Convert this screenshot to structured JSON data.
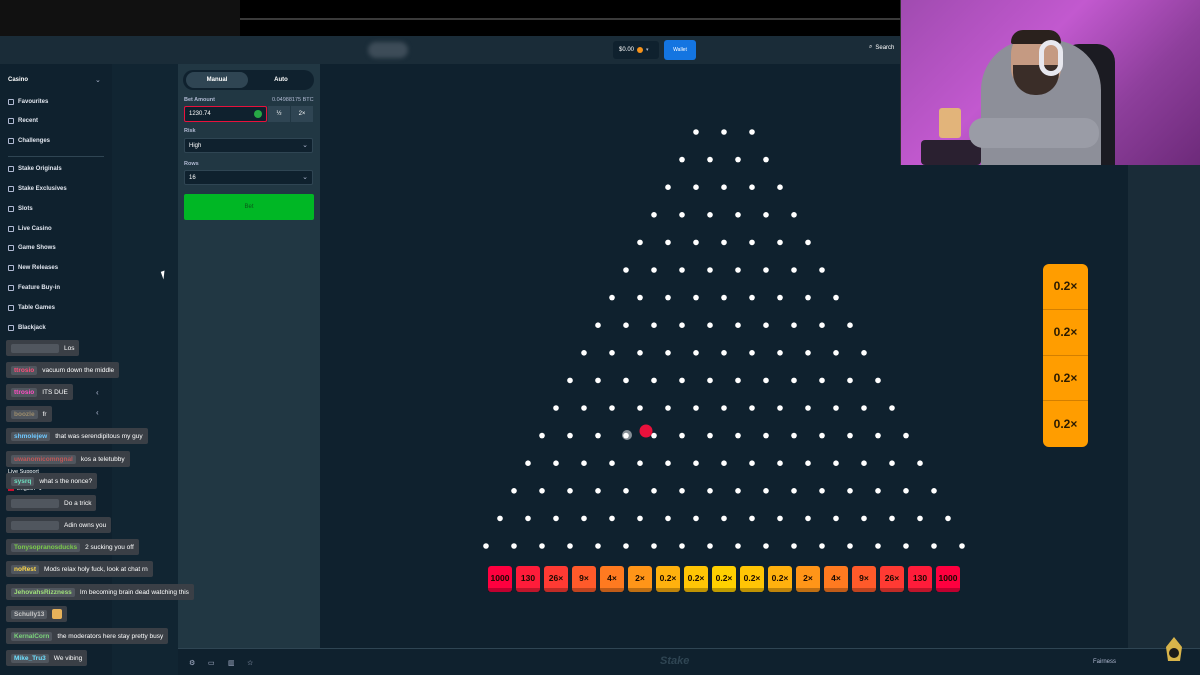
{
  "header": {
    "wallet_amount": "$0.00",
    "wallet_button": "Wallet",
    "search_label": "Search"
  },
  "sidebar": {
    "section": "Casino",
    "items": [
      {
        "label": "Favourites",
        "icon": "star-icon"
      },
      {
        "label": "Recent",
        "icon": "clock-icon"
      },
      {
        "label": "Challenges",
        "icon": "trophy-icon"
      },
      {
        "label": "Stake Originals",
        "icon": "flame-icon"
      },
      {
        "label": "Stake Exclusives",
        "icon": "gem-icon"
      },
      {
        "label": "Slots",
        "icon": "slots-icon"
      },
      {
        "label": "Live Casino",
        "icon": "live-icon"
      },
      {
        "label": "Game Shows",
        "icon": "tv-icon"
      },
      {
        "label": "New Releases",
        "icon": "rocket-icon"
      },
      {
        "label": "Feature Buy-in",
        "icon": "cart-icon"
      },
      {
        "label": "Table Games",
        "icon": "dice-icon"
      },
      {
        "label": "Blackjack",
        "icon": "cards-icon"
      }
    ],
    "live_support": "Live Support",
    "language": "English"
  },
  "controls": {
    "tab_manual": "Manual",
    "tab_auto": "Auto",
    "bet_amount_label": "Bet Amount",
    "bet_amount_btc": "0.04988175 BTC",
    "bet_amount_value": "1230.74",
    "half_label": "½",
    "double_label": "2×",
    "risk_label": "Risk",
    "risk_value": "High",
    "rows_label": "Rows",
    "rows_value": "16",
    "bet_button": "Bet"
  },
  "board": {
    "rows": 16,
    "multipliers": [
      "1000",
      "130",
      "26×",
      "9×",
      "4×",
      "2×",
      "0.2×",
      "0.2×",
      "0.2×",
      "0.2×",
      "0.2×",
      "2×",
      "4×",
      "9×",
      "26×",
      "130",
      "1000"
    ],
    "multiplier_colors": [
      "#ff003f",
      "#ff1c3a",
      "#ff3a33",
      "#ff5a2a",
      "#ff7a20",
      "#ff9518",
      "#ffb10e",
      "#ffc505",
      "#ffd000",
      "#ffc505",
      "#ffb10e",
      "#ff9518",
      "#ff7a20",
      "#ff5a2a",
      "#ff3a33",
      "#ff1c3a",
      "#ff003f"
    ],
    "ball_color": "#e9113c",
    "history": [
      "0.2×",
      "0.2×",
      "0.2×",
      "0.2×"
    ]
  },
  "chat": [
    {
      "user": "",
      "text": "Los",
      "user_color": "#8d8d8d"
    },
    {
      "user": "ttrosio",
      "text": "vacuum down the middle",
      "user_color": "#ff4d7a"
    },
    {
      "user": "ttrosio",
      "text": "ITS DUE",
      "user_color": "#ff4dc4"
    },
    {
      "user": "boozle",
      "text": "fr",
      "user_color": "#9c8c6c"
    },
    {
      "user": "shmolejew",
      "text": "that was serendipitous my guy",
      "user_color": "#6ec8ff"
    },
    {
      "user": "uwanomicomngnal",
      "text": "kos a teletubby",
      "user_color": "#c05858"
    },
    {
      "user": "sysrq",
      "text": "what s the nonce?",
      "user_color": "#6ee0c0"
    },
    {
      "user": "",
      "text": "Do a trick",
      "user_color": "#5a5a5a"
    },
    {
      "user": "",
      "text": "Adin owns you",
      "user_color": "#6a6a6a"
    },
    {
      "user": "Tonysopranosducks",
      "text": "2 sucking you off",
      "user_color": "#7acc4a"
    },
    {
      "user": "noRest",
      "text": "Mods relax holy fuck, look at chat rn",
      "user_color": "#ffd84a"
    },
    {
      "user": "JehovahsRizzness",
      "text": "Im becoming brain dead watching this",
      "user_color": "#9fe07a"
    },
    {
      "user": "Schully13",
      "text": "",
      "user_color": "#c8c8c8"
    },
    {
      "user": "KernalCorn",
      "text": "the moderators here stay pretty busy",
      "user_color": "#7ad47a"
    },
    {
      "user": "Mike_Tru3",
      "text": "We vibing",
      "user_color": "#6ee0ff"
    }
  ],
  "footer": {
    "logo": "Stake",
    "fairness": "Fairness"
  }
}
